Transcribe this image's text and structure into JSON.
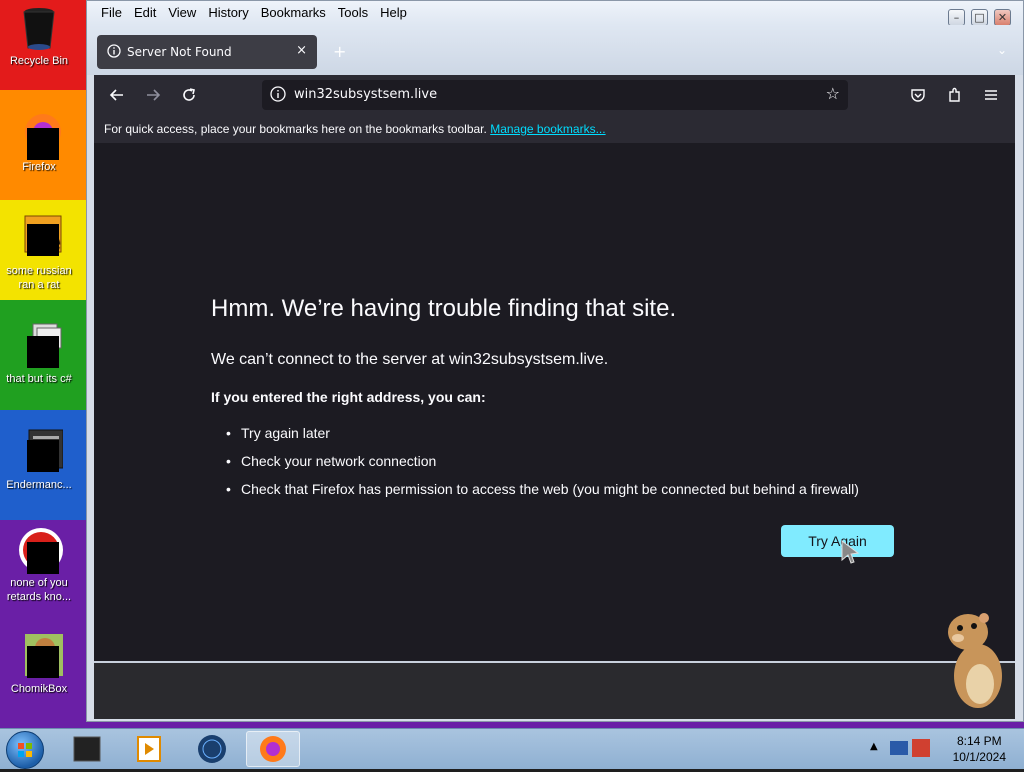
{
  "desktop": {
    "icons": [
      {
        "label": "Recycle Bin"
      },
      {
        "label": "Firefox"
      },
      {
        "label": "some russian ran a rat"
      },
      {
        "label": "that but its c#"
      },
      {
        "label": "Endermanc..."
      },
      {
        "label": "none of you retards kno..."
      },
      {
        "label": "ChomikBox"
      }
    ]
  },
  "menubar": {
    "items": [
      "File",
      "Edit",
      "View",
      "History",
      "Bookmarks",
      "Tools",
      "Help"
    ]
  },
  "tab": {
    "title": "Server Not Found",
    "close": "×"
  },
  "urlbar": {
    "url": "win32subsystsem.live"
  },
  "bookmarks_bar": {
    "text": "For quick access, place your bookmarks here on the bookmarks toolbar.",
    "link": "Manage bookmarks..."
  },
  "error_page": {
    "title": "Hmm. We’re having trouble finding that site.",
    "subtitle": "We can’t connect to the server at win32subsystsem.live.",
    "lead": "If you entered the right address, you can:",
    "suggestions": [
      "Try again later",
      "Check your network connection",
      "Check that Firefox has permission to access the web (you might be connected but behind a firewall)"
    ],
    "button": "Try Again"
  },
  "taskbar": {
    "time": "8:14 PM",
    "date": "10/1/2024"
  },
  "colors": {
    "accent_button": "#80ebff",
    "page_bg": "#1c1b22",
    "toolbar_bg": "#2b2a33",
    "link": "#00ddff"
  }
}
